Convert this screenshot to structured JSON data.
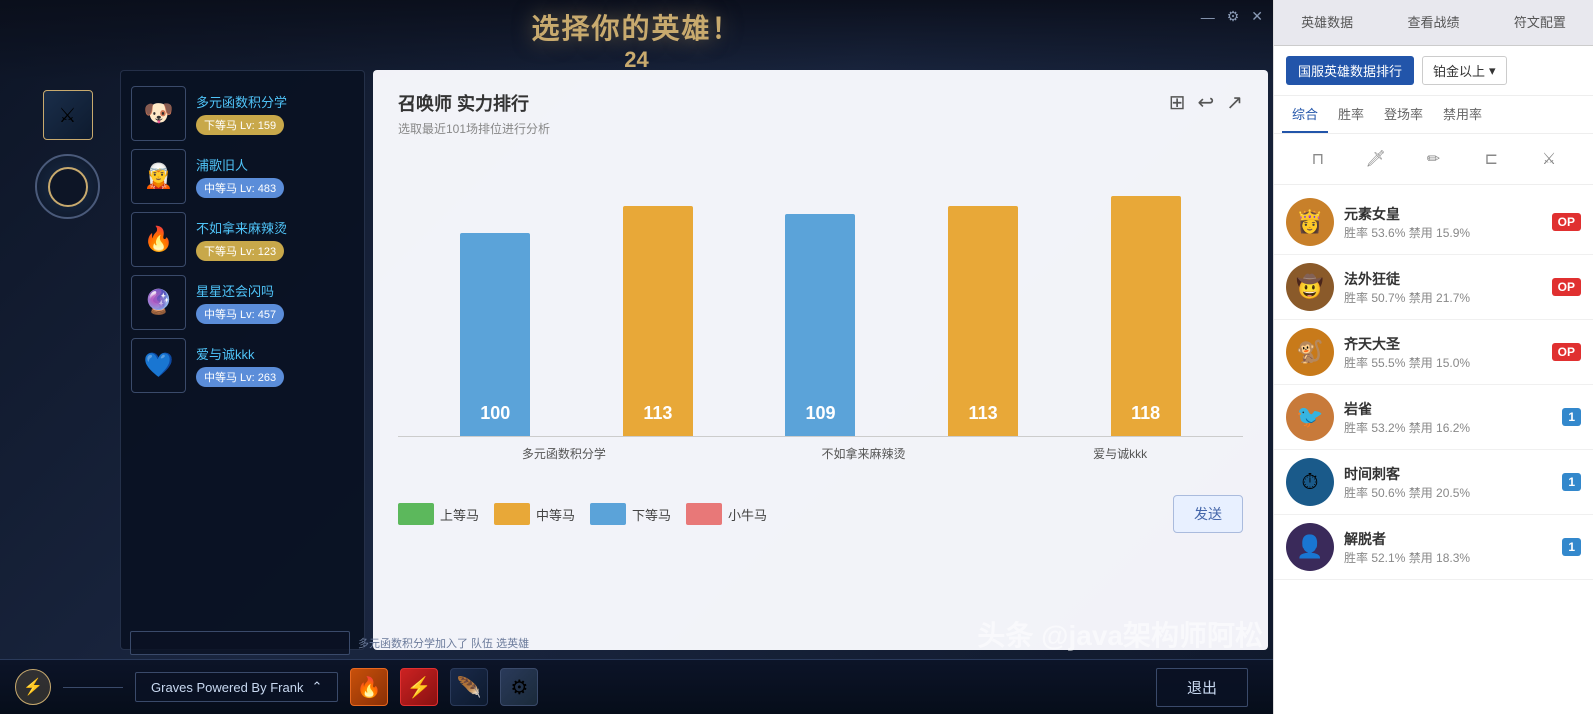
{
  "app": {
    "title": "选择你的英雄！",
    "subtitle": "24",
    "window_controls": [
      "—",
      "⚙",
      "✕"
    ]
  },
  "header": {
    "corner_deco": "◆"
  },
  "players": [
    {
      "id": 1,
      "name": "多元函数积分学",
      "rank": "下等马 Lv: 159",
      "rank_class": "rank-gold",
      "avatar_emoji": "🐶"
    },
    {
      "id": 2,
      "name": "浦歌旧人",
      "rank": "中等马 Lv: 483",
      "rank_class": "rank-diamond",
      "avatar_emoji": "🧝"
    },
    {
      "id": 3,
      "name": "不如拿来麻辣烫",
      "rank": "下等马 Lv: 123",
      "rank_class": "rank-gold",
      "avatar_emoji": "🔥"
    },
    {
      "id": 4,
      "name": "星星还会闪吗",
      "rank": "中等马 Lv: 457",
      "rank_class": "rank-diamond",
      "avatar_emoji": "🔮"
    },
    {
      "id": 5,
      "name": "爱与诚kkk",
      "rank": "中等马 Lv: 263",
      "rank_class": "rank-diamond",
      "avatar_emoji": "💙"
    }
  ],
  "chart": {
    "title": "召唤师 实力排行",
    "subtitle": "选取最近101场排位进行分析",
    "toolbar": [
      "⊞",
      "↩",
      "↗"
    ],
    "bars": [
      {
        "name": "多元函数积分学",
        "value": 100,
        "type": "blue"
      },
      {
        "name": "多元函数积分学",
        "value": 113,
        "type": "orange"
      },
      {
        "name": "不如拿来麻辣烫",
        "value": 109,
        "type": "blue"
      },
      {
        "name": "不如拿来麻辣烫",
        "value": 113,
        "type": "orange"
      },
      {
        "name": "爱与诚kkk",
        "value": 118,
        "type": "orange"
      }
    ],
    "name_labels": [
      "多元函数积分学",
      "不如拿来麻辣烫",
      "爱与诚kkk"
    ],
    "legend": [
      {
        "label": "上等马",
        "class": "legend-green"
      },
      {
        "label": "中等马",
        "class": "legend-orange"
      },
      {
        "label": "下等马",
        "class": "legend-blue"
      },
      {
        "label": "小牛马",
        "class": "legend-pink"
      }
    ],
    "send_btn": "发送"
  },
  "status_bar": {
    "text": "多元函数积分学加入了 队伍 选英雄"
  },
  "taskbar": {
    "icon_btn": "⚡",
    "champion_name": "Graves Powered By Frank",
    "champion_arrow": "⌃",
    "spell1": "🔥",
    "spell2": "🔴",
    "spell3": "🪶",
    "spell4": "⚙",
    "exit_btn": "退出"
  },
  "right_panel": {
    "tabs": [
      {
        "label": "英雄数据",
        "active": false
      },
      {
        "label": "查看战绩",
        "active": false
      },
      {
        "label": "符文配置",
        "active": false
      }
    ],
    "filter_btn": "国服英雄数据排行",
    "filter_dropdown": "铂金以上",
    "sub_tabs": [
      {
        "label": "综合",
        "active": true
      },
      {
        "label": "胜率",
        "active": false
      },
      {
        "label": "登场率",
        "active": false
      },
      {
        "label": "禁用率",
        "active": false
      }
    ],
    "role_icons": [
      "⊓",
      "🗡",
      "✏",
      "⊏",
      "⚔"
    ],
    "champions": [
      {
        "name": "元素女皇",
        "stats": "胜率 53.6%  禁用 15.9%",
        "badge": "OP",
        "badge_class": "badge-op",
        "avatar_emoji": "👸",
        "avatar_bg": "#c8802a"
      },
      {
        "name": "法外狂徒",
        "stats": "胜率 50.7%  禁用 21.7%",
        "badge": "OP",
        "badge_class": "badge-op",
        "avatar_emoji": "🤠",
        "avatar_bg": "#8a5a2a"
      },
      {
        "name": "齐天大圣",
        "stats": "胜率 55.5%  禁用 15.0%",
        "badge": "OP",
        "badge_class": "badge-op",
        "avatar_emoji": "🐒",
        "avatar_bg": "#c87a1a"
      },
      {
        "name": "岩雀",
        "stats": "胜率 53.2%  禁用 16.2%",
        "badge": "1",
        "badge_class": "badge-1",
        "avatar_emoji": "🐦",
        "avatar_bg": "#c87a3a"
      },
      {
        "name": "时间刺客",
        "stats": "胜率 50.6%  禁用 20.5%",
        "badge": "1",
        "badge_class": "badge-1",
        "avatar_emoji": "⏱",
        "avatar_bg": "#1a5a8a"
      },
      {
        "name": "解脱者",
        "stats": "胜率 52.1%  禁用 18.3%",
        "badge": "1",
        "badge_class": "badge-1",
        "avatar_emoji": "👤",
        "avatar_bg": "#3a2a5a"
      }
    ]
  },
  "watermark": "头条 @java架构师阿松"
}
